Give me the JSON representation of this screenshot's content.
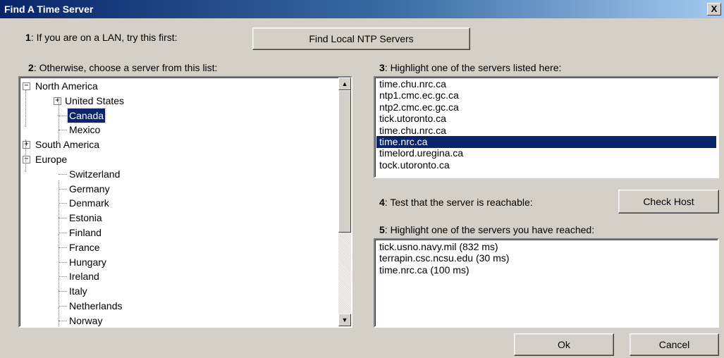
{
  "window": {
    "title": "Find A Time Server",
    "close_label": "X"
  },
  "step1": {
    "num": "1",
    "text": ": If you are on a LAN, try this first:",
    "button": "Find Local NTP Servers"
  },
  "step2": {
    "num": "2",
    "text": ": Otherwise, choose a server from this list:"
  },
  "tree": {
    "items": [
      {
        "label": "North America",
        "expander": "−"
      },
      {
        "label": "United States",
        "expander": "+"
      },
      {
        "label": "Canada",
        "selected": true
      },
      {
        "label": "Mexico"
      },
      {
        "label": "South America",
        "expander": "+"
      },
      {
        "label": "Europe",
        "expander": "−"
      },
      {
        "label": "Switzerland"
      },
      {
        "label": "Germany"
      },
      {
        "label": "Denmark"
      },
      {
        "label": "Estonia"
      },
      {
        "label": "Finland"
      },
      {
        "label": "France"
      },
      {
        "label": "Hungary"
      },
      {
        "label": "Ireland"
      },
      {
        "label": "Italy"
      },
      {
        "label": "Netherlands"
      },
      {
        "label": "Norway"
      }
    ]
  },
  "step3": {
    "num": "3",
    "text": ": Highlight one of the servers listed here:",
    "servers": [
      "time.chu.nrc.ca",
      "ntp1.cmc.ec.gc.ca",
      "ntp2.cmc.ec.gc.ca",
      "tick.utoronto.ca",
      "time.chu.nrc.ca",
      "time.nrc.ca",
      "timelord.uregina.ca",
      "tock.utoronto.ca"
    ],
    "selected_index": 5
  },
  "step4": {
    "num": "4",
    "text": ": Test that the server is reachable:",
    "button": "Check Host"
  },
  "step5": {
    "num": "5",
    "text": ": Highlight one of the servers you have reached:",
    "reached": [
      "tick.usno.navy.mil (832 ms)",
      "terrapin.csc.ncsu.edu (30 ms)",
      "time.nrc.ca (100 ms)"
    ]
  },
  "buttons": {
    "ok": "Ok",
    "cancel": "Cancel"
  }
}
